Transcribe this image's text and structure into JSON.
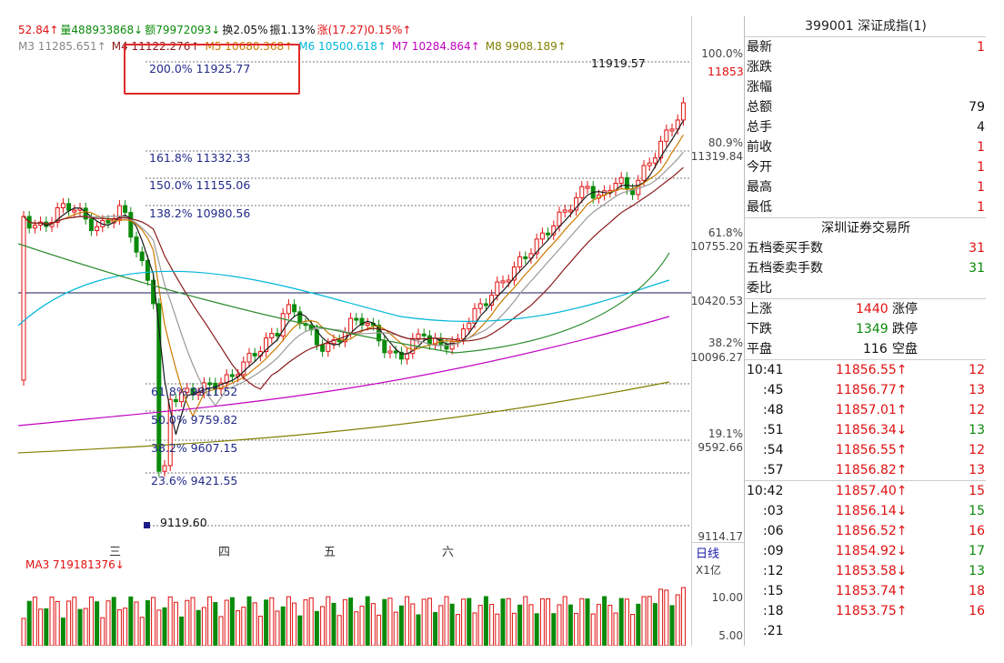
{
  "header": {
    "info_parts": [
      {
        "text": "52.84↑",
        "color": "#e01010"
      },
      {
        "text": "量488933868↓",
        "color": "#0a8a0a"
      },
      {
        "text": "额79972093↓",
        "color": "#0a8a0a"
      },
      {
        "text": "换2.05%",
        "color": "#111111"
      },
      {
        "text": "振1.13%",
        "color": "#111111"
      },
      {
        "text": "涨(17.27)0.15%↑",
        "color": "#e01010"
      }
    ],
    "ma_parts": [
      {
        "text": "M3 11285.651↑",
        "color": "#888888"
      },
      {
        "text": "M4 11122.276↑",
        "color": "#8b1a1a"
      },
      {
        "text": "M5 10680.368↑",
        "color": "#cc7a00"
      },
      {
        "text": "M6 10500.618↑",
        "color": "#00b7d9"
      },
      {
        "text": "M7 10284.864↑",
        "color": "#c000c0"
      },
      {
        "text": "M8 9908.189↑",
        "color": "#808000"
      }
    ]
  },
  "fib_levels": [
    {
      "label": "200.0% 11925.77"
    },
    {
      "label": "161.8% 11332.33"
    },
    {
      "label": "150.0% 11155.06"
    },
    {
      "label": "138.2% 10980.56"
    },
    {
      "label": "61.8% 9911.52"
    },
    {
      "label": "50.0% 9759.82"
    },
    {
      "label": "38.2% 9607.15"
    },
    {
      "label": "23.6% 9421.55"
    },
    {
      "label": "9119.60"
    }
  ],
  "annotations": {
    "high_marker": "11919.57",
    "last_price": "11853"
  },
  "price_axis": [
    {
      "label": "100.0%"
    },
    {
      "label": "80.9%"
    },
    {
      "label": "11319.84"
    },
    {
      "label": "61.8%"
    },
    {
      "label": "10755.20"
    },
    {
      "label": "10420.53"
    },
    {
      "label": "38.2%"
    },
    {
      "label": "10096.27"
    },
    {
      "label": "19.1%"
    },
    {
      "label": "9592.66"
    },
    {
      "label": "9114.17"
    }
  ],
  "x_axis": [
    "三",
    "四",
    "五",
    "六"
  ],
  "period_button": "日线",
  "volume": {
    "header": "MA3 719181376↓",
    "unit": "X1亿",
    "ticks": [
      "10.00",
      "5.00"
    ]
  },
  "panel": {
    "title": "399001 深证成指(1)",
    "quote_rows": [
      {
        "label": "最新",
        "value": "1"
      },
      {
        "label": "涨跌",
        "value": ""
      },
      {
        "label": "涨幅",
        "value": ""
      },
      {
        "label": "总额",
        "value": "79"
      },
      {
        "label": "总手",
        "value": "4"
      },
      {
        "label": "前收",
        "value": "1"
      },
      {
        "label": "今开",
        "value": "1"
      },
      {
        "label": "最高",
        "value": "1"
      },
      {
        "label": "最低",
        "value": "1"
      }
    ],
    "exchange": "深圳证券交易所",
    "book_rows": [
      {
        "label": "五档委买手数",
        "value": "31",
        "color": "#e01010"
      },
      {
        "label": "五档委卖手数",
        "value": "31",
        "color": "#0a8a0a"
      },
      {
        "label": "委比",
        "value": "",
        "color": "#111111"
      }
    ],
    "breadth": {
      "up_label": "上涨",
      "up_count": "1440",
      "limit_up": "涨停",
      "down_label": "下跌",
      "down_count": "1349",
      "limit_down": "跌停",
      "flat_label": "平盘",
      "flat_count": "116",
      "empty": "空盘"
    },
    "ticks": [
      {
        "time": "10:41",
        "price": "11856.55↑",
        "vol": "12",
        "color": "#e01010",
        "vcolor": "#e01010"
      },
      {
        "time": ":45",
        "price": "11856.77↑",
        "vol": "13",
        "color": "#e01010",
        "vcolor": "#e01010"
      },
      {
        "time": ":48",
        "price": "11857.01↑",
        "vol": "12",
        "color": "#e01010",
        "vcolor": "#e01010"
      },
      {
        "time": ":51",
        "price": "11856.34↓",
        "vol": "13",
        "color": "#e01010",
        "vcolor": "#0a8a0a"
      },
      {
        "time": ":54",
        "price": "11856.55↑",
        "vol": "12",
        "color": "#e01010",
        "vcolor": "#e01010"
      },
      {
        "time": ":57",
        "price": "11856.82↑",
        "vol": "13",
        "color": "#e01010",
        "vcolor": "#e01010"
      },
      {
        "time": "10:42",
        "price": "11857.40↑",
        "vol": "15",
        "color": "#e01010",
        "vcolor": "#e01010"
      },
      {
        "time": ":03",
        "price": "11856.14↓",
        "vol": "15",
        "color": "#e01010",
        "vcolor": "#0a8a0a"
      },
      {
        "time": ":06",
        "price": "11856.52↑",
        "vol": "16",
        "color": "#e01010",
        "vcolor": "#e01010"
      },
      {
        "time": ":09",
        "price": "11854.92↓",
        "vol": "17",
        "color": "#e01010",
        "vcolor": "#0a8a0a"
      },
      {
        "time": ":12",
        "price": "11853.58↓",
        "vol": "13",
        "color": "#e01010",
        "vcolor": "#0a8a0a"
      },
      {
        "time": ":15",
        "price": "11853.74↑",
        "vol": "18",
        "color": "#e01010",
        "vcolor": "#e01010"
      },
      {
        "time": ":18",
        "price": "11853.75↑",
        "vol": "16",
        "color": "#e01010",
        "vcolor": "#e01010"
      },
      {
        "time": ":21",
        "price": "",
        "vol": "",
        "color": "#e01010",
        "vcolor": "#e01010"
      }
    ]
  },
  "colors": {
    "up": "#e01010",
    "down": "#0a8a0a",
    "fib_text": "#222a88",
    "highlight": "#e02a2a"
  }
}
